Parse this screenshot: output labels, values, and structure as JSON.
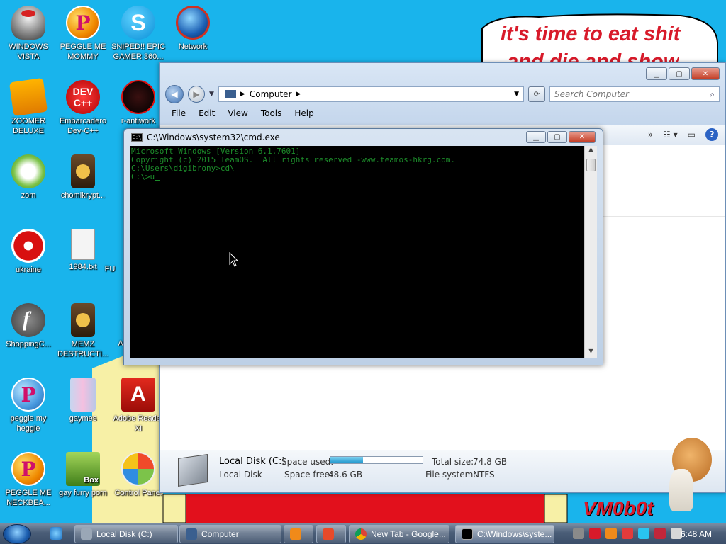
{
  "desktop": {
    "icons": [
      {
        "label": "WINDOWS VISTA"
      },
      {
        "label": "PEGGLE ME MOMMY"
      },
      {
        "label": "SNIPED!! EPIC GAMER 360..."
      },
      {
        "label": "Network"
      },
      {
        "label": "ZOOMER DELUXE"
      },
      {
        "label": "Embarcadero Dev-C++"
      },
      {
        "label": "r-antiwork"
      },
      {
        "label": "zom"
      },
      {
        "label": "chomikrypt..."
      },
      {
        "label": "ukraine"
      },
      {
        "label": "1984.txt"
      },
      {
        "label": "FU"
      },
      {
        "label": "ShoppingC..."
      },
      {
        "label": "MEMZ DESTRUCTI..."
      },
      {
        "label": "A"
      },
      {
        "label": "peggle my heggle"
      },
      {
        "label": "gaymes"
      },
      {
        "label": "Adobe Reader XI"
      },
      {
        "label": "PEGGLE ME NECKBEA..."
      },
      {
        "label": "gay furry porn"
      },
      {
        "label": "Control Panel"
      }
    ],
    "badges": {
      "dev": "DEV C++",
      "box": "Box",
      "adobe": "A",
      "peggle": "P",
      "skype": "S"
    },
    "speech_text": "it's time to eat shit",
    "speech_text_2": "and die and show",
    "watermark": "VM0b0t"
  },
  "explorer": {
    "address": "Computer",
    "search_placeholder": "Search Computer",
    "menu": [
      "File",
      "Edit",
      "View",
      "Tools",
      "Help"
    ],
    "help_label": "?",
    "drive": {
      "name": "Local Disk (C:)",
      "type": "Local Disk",
      "space_used_label": "Space used:",
      "used_fraction": 0.35,
      "space_free_label": "Space free:",
      "space_free": "48.6 GB",
      "total_size_label": "Total size:",
      "total_size": "74.8 GB",
      "fs_label": "File system:",
      "fs": "NTFS"
    }
  },
  "cmd": {
    "title": "C:\\Windows\\system32\\cmd.exe",
    "icon_text": "C:\\",
    "lines": [
      "Microsoft Windows [Version 6.1.7601]",
      "Copyright (c) 2015 TeamOS.  All rights reserved -www.teamos-hkrg.com.",
      "",
      "C:\\Users\\digibrony>cd\\",
      "",
      "C:\\>u"
    ]
  },
  "taskbar": {
    "tasks": [
      {
        "label": "Local Disk (C:)"
      },
      {
        "label": "Computer"
      },
      {
        "label": ""
      },
      {
        "label": ""
      },
      {
        "label": "New Tab - Google..."
      },
      {
        "label": "C:\\Windows\\syste..."
      }
    ],
    "clock": "6:48 AM"
  },
  "colors": {
    "accent": "#d81a2a",
    "desktop": "#19b4ec",
    "console_text": "#1c8b2a"
  }
}
